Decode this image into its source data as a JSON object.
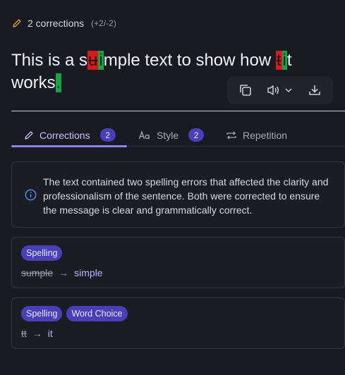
{
  "header": {
    "icon": "pencil-icon",
    "corrections_count": "2 corrections",
    "delta": "(+2/-2)"
  },
  "text": {
    "seg1": "This is a s",
    "del1": "u",
    "ins1": "i",
    "seg2": "mple text to show how ",
    "del2": "t",
    "ins2": "i",
    "seg3": "t",
    "seg4": "works",
    "ins3": "."
  },
  "toolbar": {
    "copy_icon": "copy-icon",
    "speaker_icon": "speaker-icon",
    "chevron_icon": "chevron-down-icon",
    "download_icon": "download-icon"
  },
  "tabs": [
    {
      "label": "Corrections",
      "badge": "2",
      "icon": "pencil-icon"
    },
    {
      "label": "Style",
      "badge": "2",
      "icon": "font-icon"
    },
    {
      "label": "Repetition",
      "icon": "repeat-icon"
    }
  ],
  "info": {
    "text": "The text contained two spelling errors that affected the clarity and professionalism of the sentence. Both were corrected to ensure the message is clear and grammatically correct."
  },
  "corrections": [
    {
      "tags": [
        "Spelling"
      ],
      "old": "sumple",
      "arrow": "→",
      "new": "simple"
    },
    {
      "tags": [
        "Spelling",
        "Word Choice"
      ],
      "old": "tt",
      "arrow": "→",
      "new": "it"
    }
  ],
  "colors": {
    "background": "#1a1b22",
    "accent": "#8b85ff",
    "badge": "#4a3fb8",
    "deletion": "#d71a1a",
    "insertion": "#16a34a",
    "pencil": "#e0a83a"
  }
}
